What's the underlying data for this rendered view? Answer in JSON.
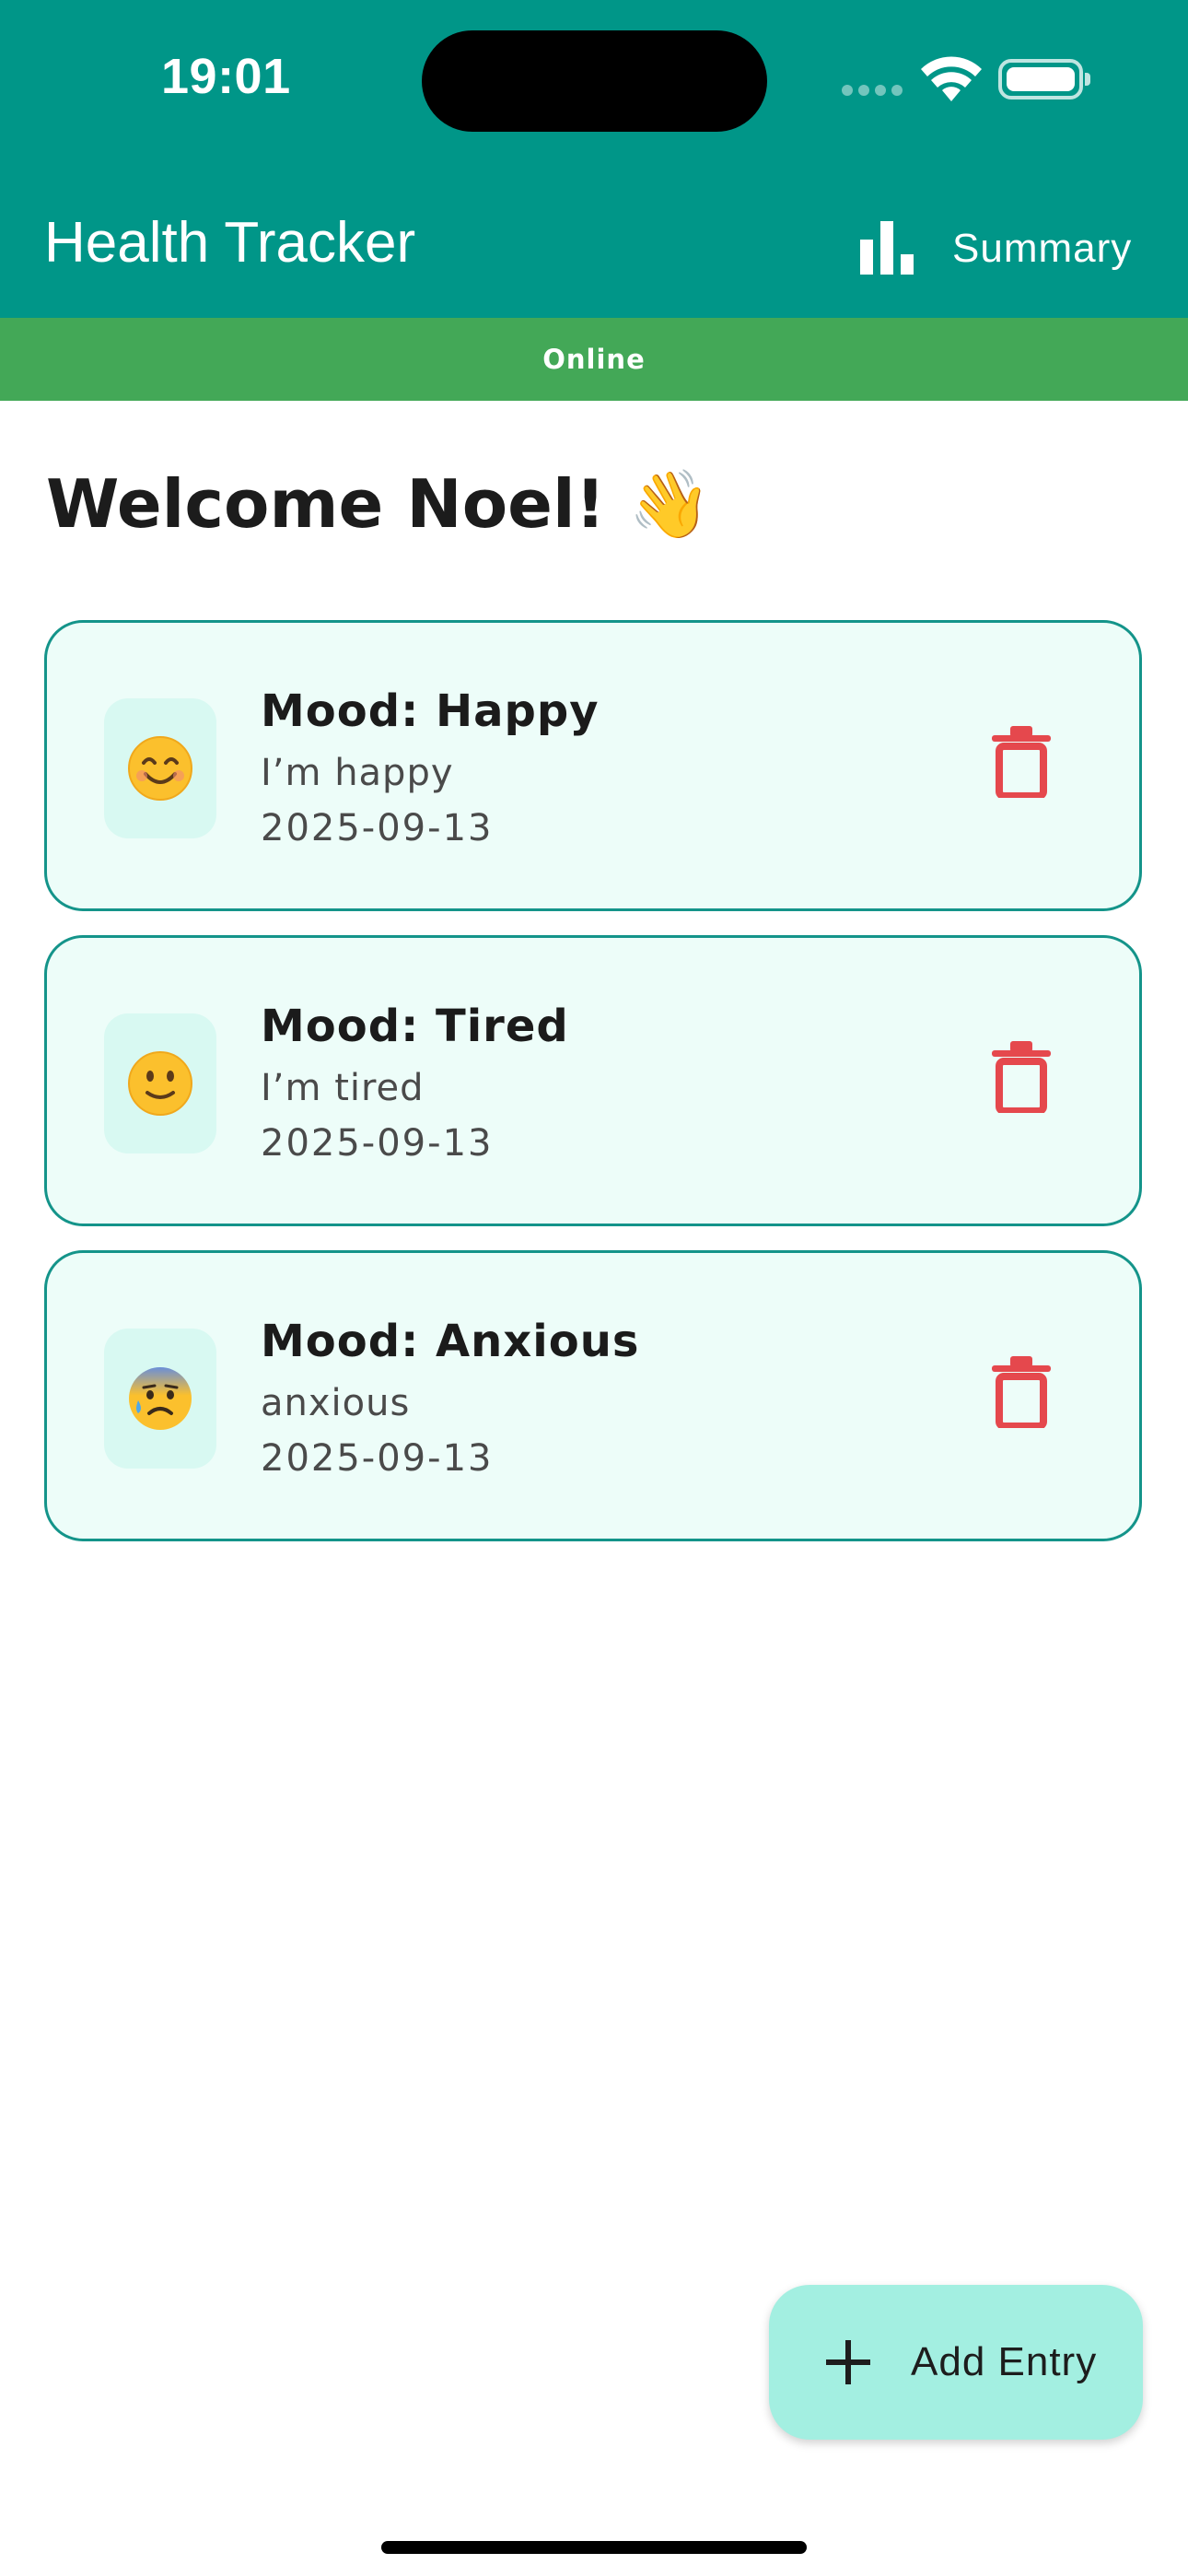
{
  "status_bar": {
    "time": "19:01"
  },
  "app_bar": {
    "title": "Health Tracker",
    "summary_label": "Summary"
  },
  "connection": {
    "status": "Online"
  },
  "welcome": {
    "text": "Welcome Noel! 👋"
  },
  "entries": [
    {
      "mood_label": "Mood: Happy",
      "note": "I’m happy",
      "date": "2025-09-13",
      "emoji_icon": "smiling-face-icon"
    },
    {
      "mood_label": "Mood: Tired",
      "note": "I’m tired",
      "date": "2025-09-13",
      "emoji_icon": "slight-smile-icon"
    },
    {
      "mood_label": "Mood: Anxious",
      "note": "anxious",
      "date": "2025-09-13",
      "emoji_icon": "anxious-face-icon"
    }
  ],
  "fab": {
    "label": "Add Entry"
  },
  "colors": {
    "primary": "#009688",
    "online": "#43a857",
    "card_border": "#14948a",
    "card_background": "#edfdf9",
    "delete": "#e5484d",
    "fab_background": "#a3efe1"
  }
}
